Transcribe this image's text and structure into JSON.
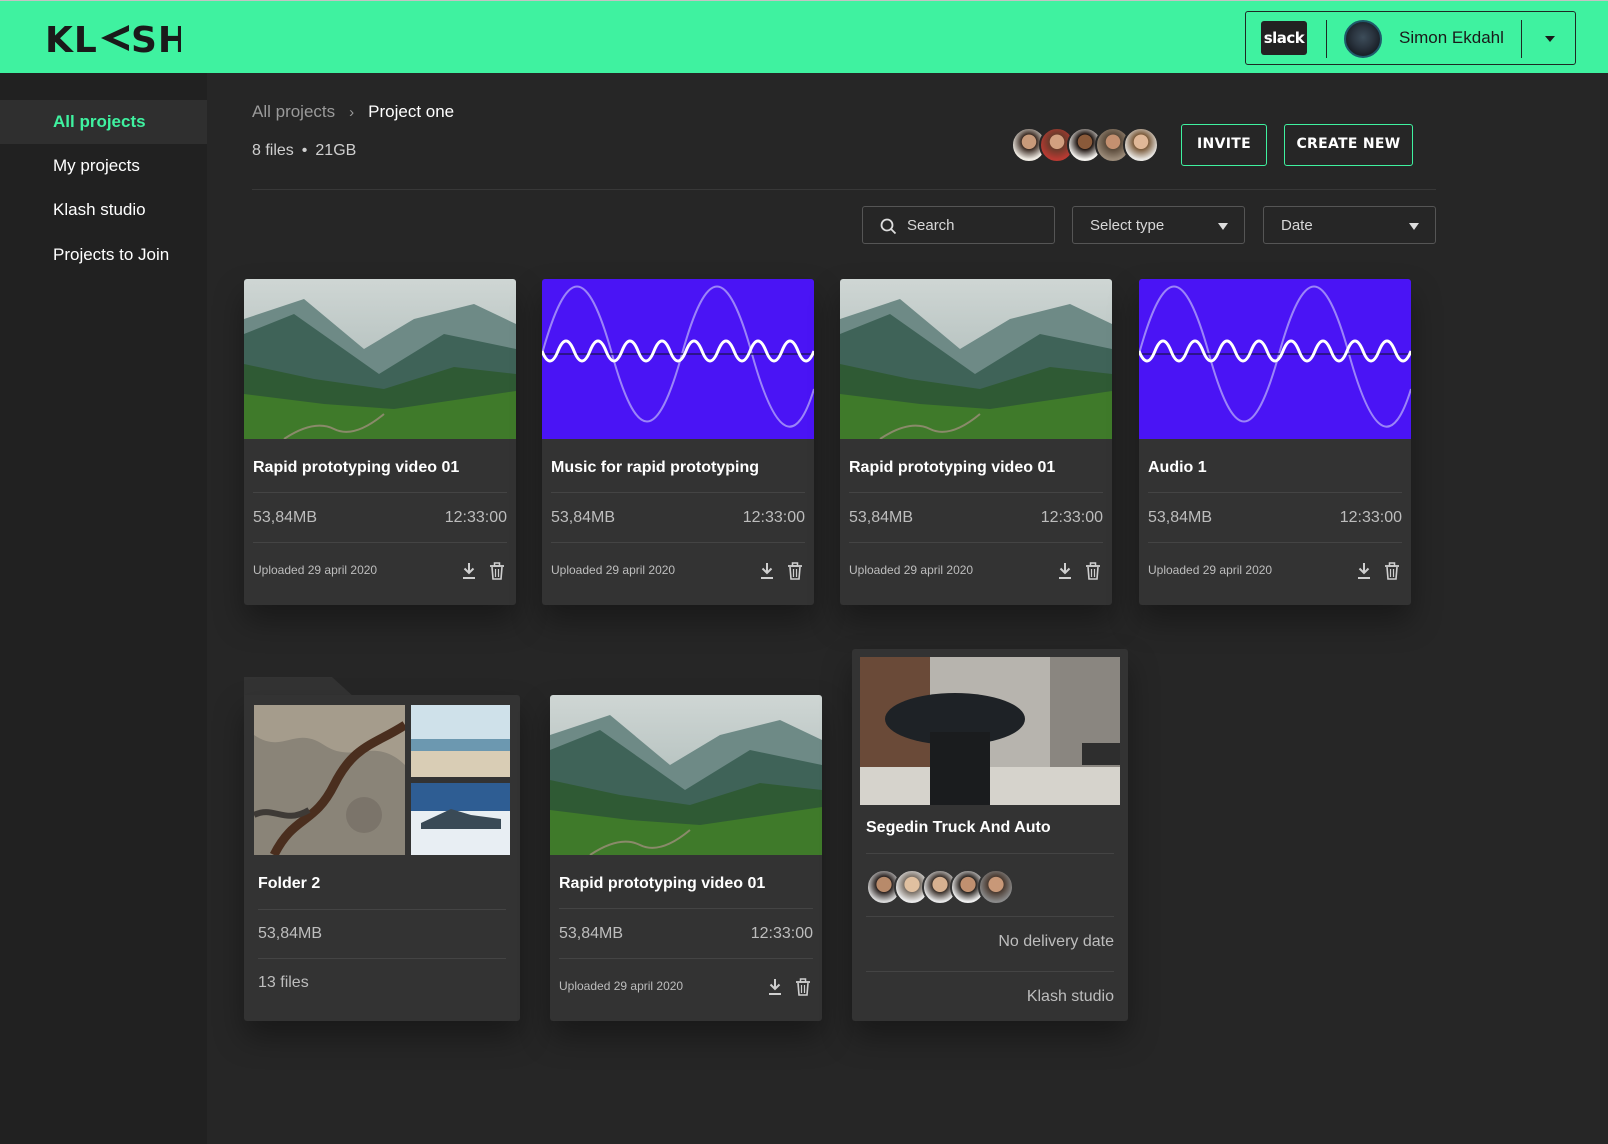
{
  "app": {
    "name": "KLASH"
  },
  "account": {
    "slack_label": "slack",
    "user_name": "Simon Ekdahl"
  },
  "sidebar": {
    "items": [
      {
        "label": "All projects",
        "active": true
      },
      {
        "label": "My projects",
        "active": false
      },
      {
        "label": "Klash studio",
        "active": false
      },
      {
        "label": "Projects to Join",
        "active": false
      }
    ]
  },
  "breadcrumb": {
    "parent": "All projects",
    "separator": "›",
    "current": "Project one"
  },
  "project_meta": {
    "files": "8 files",
    "dot": "•",
    "size": "21GB"
  },
  "actions": {
    "invite": "INVITE",
    "create_new": "CREATE NEW"
  },
  "filters": {
    "search_placeholder": "Search",
    "type_label": "Select type",
    "date_label": "Date"
  },
  "cards": [
    {
      "kind": "video",
      "title": "Rapid prototyping video 01",
      "size": "53,84MB",
      "duration": "12:33:00",
      "uploaded": "Uploaded 29 april 2020"
    },
    {
      "kind": "audio",
      "title": "Music for rapid prototyping",
      "size": "53,84MB",
      "duration": "12:33:00",
      "uploaded": "Uploaded 29 april 2020"
    },
    {
      "kind": "video",
      "title": "Rapid prototyping video 01",
      "size": "53,84MB",
      "duration": "12:33:00",
      "uploaded": "Uploaded 29 april 2020"
    },
    {
      "kind": "audio",
      "title": "Audio 1",
      "size": "53,84MB",
      "duration": "12:33:00",
      "uploaded": "Uploaded 29 april 2020"
    }
  ],
  "folder": {
    "title": "Folder 2",
    "size": "53,84MB",
    "count": "13 files"
  },
  "video_card_2": {
    "title": "Rapid prototyping video 01",
    "size": "53,84MB",
    "duration": "12:33:00",
    "uploaded": "Uploaded 29 april 2020"
  },
  "project_card": {
    "title": "Segedin Truck And Auto",
    "delivery": "No delivery date",
    "studio": "Klash studio"
  },
  "colors": {
    "accent": "#3ff2a0",
    "audio_bg": "#4a14f5",
    "background": "#262626",
    "card": "#333333"
  }
}
